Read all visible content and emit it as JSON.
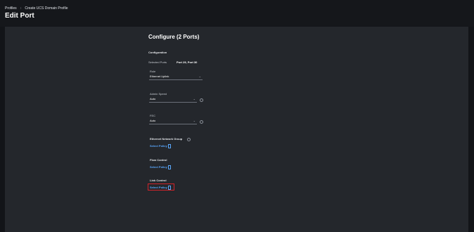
{
  "breadcrumb": {
    "item1": "Profiles",
    "separator": "›",
    "item2": "Create UCS Domain Profile"
  },
  "page_title": "Edit Port",
  "form": {
    "title": "Configure (2 Ports)",
    "section": "Configuration",
    "selected_ports_label": "Selected Ports",
    "selected_ports_value": "Port 29, Port 30",
    "role": {
      "label": "Role",
      "value": "Ethernet Uplink"
    },
    "admin_speed": {
      "label": "Admin Speed",
      "value": "Auto"
    },
    "fec": {
      "label": "FEC",
      "value": "Auto"
    },
    "ethernet_network_group": {
      "label": "Ethernet Network Group",
      "link": "Select Policy"
    },
    "flow_control": {
      "label": "Flow Control",
      "link": "Select Policy"
    },
    "link_control": {
      "label": "Link Control",
      "link": "Select Policy"
    }
  },
  "colors": {
    "accent_link": "#5aa8ff",
    "highlight": "#d0232b",
    "background": "#24272c"
  },
  "icons": {
    "chevron": "chevron-down-icon",
    "info": "info-icon",
    "policy": "document-icon"
  }
}
